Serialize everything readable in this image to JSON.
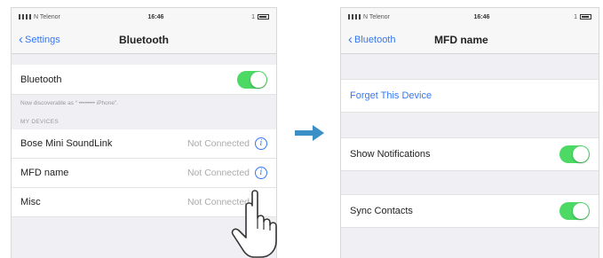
{
  "left": {
    "status": {
      "carrier": "N Telenor",
      "time": "16:46",
      "right": "1"
    },
    "nav": {
      "back": "Settings",
      "title": "Bluetooth"
    },
    "bluetooth_label": "Bluetooth",
    "discoverable_text": "Now discoverable as “ •••••••• iPhone”.",
    "section_header": "MY DEVICES",
    "devices": [
      {
        "name": "Bose Mini SoundLink",
        "status": "Not Connected"
      },
      {
        "name": "MFD name",
        "status": "Not Connected"
      },
      {
        "name": "Misc",
        "status": "Not Connected"
      }
    ]
  },
  "right": {
    "status": {
      "carrier": "N Telenor",
      "time": "16:46",
      "right": "1"
    },
    "nav": {
      "back": "Bluetooth",
      "title": "MFD name"
    },
    "forget_label": "Forget This Device",
    "show_notifications_label": "Show Notifications",
    "sync_contacts_label": "Sync Contacts"
  },
  "colors": {
    "accent": "#3478f6",
    "toggle_on": "#4cd964",
    "arrow": "#3a8fc7"
  },
  "icons": [
    "info-icon",
    "chevron-left-icon",
    "arrow-right-icon",
    "hand-pointer-icon",
    "battery-icon",
    "signal-icon"
  ]
}
